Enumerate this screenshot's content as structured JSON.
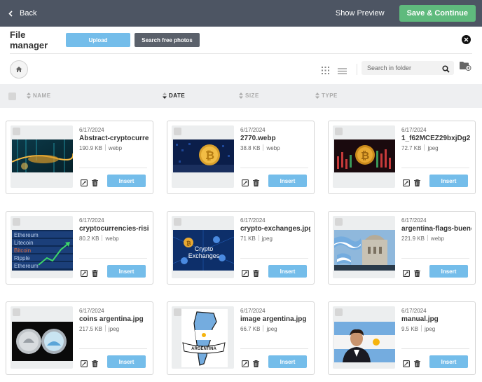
{
  "topbar": {
    "back_label": "Back",
    "show_preview_label": "Show Preview",
    "save_label": "Save & Continue"
  },
  "header": {
    "title": "File manager",
    "upload_label": "Upload",
    "search_photos_label": "Search free photos"
  },
  "toolbar": {
    "search_placeholder": "Search in folder"
  },
  "columns": {
    "name": "NAME",
    "date": "DATE",
    "size": "SIZE",
    "type": "TYPE"
  },
  "files": [
    {
      "date": "6/17/2024",
      "name": "Abstract-cryptocurrency",
      "size": "190.9 KB",
      "type": "webp",
      "thumb": "matrix"
    },
    {
      "date": "6/17/2024",
      "name": "2770.webp",
      "size": "38.8 KB",
      "type": "webp",
      "thumb": "bitcoin-blue"
    },
    {
      "date": "6/17/2024",
      "name": "1_f62MCEZ29bxjDg2",
      "size": "72.7 KB",
      "type": "jpeg",
      "thumb": "bitcoin-red"
    },
    {
      "date": "6/17/2024",
      "name": "cryptocurrencies-rising",
      "size": "80.2 KB",
      "type": "webp",
      "thumb": "crypto-rising"
    },
    {
      "date": "6/17/2024",
      "name": "crypto-exchanges.jpg",
      "size": "71 KB",
      "type": "jpeg",
      "thumb": "exchanges"
    },
    {
      "date": "6/17/2024",
      "name": "argentina-flags-buenos",
      "size": "221.9 KB",
      "type": "webp",
      "thumb": "flags"
    },
    {
      "date": "6/17/2024",
      "name": "coins argentina.jpg",
      "size": "217.5 KB",
      "type": "jpeg",
      "thumb": "coins"
    },
    {
      "date": "6/17/2024",
      "name": "image argentina.jpg",
      "size": "66.7 KB",
      "type": "jpeg",
      "thumb": "map"
    },
    {
      "date": "6/17/2024",
      "name": "manual.jpg",
      "size": "9.5 KB",
      "type": "jpeg",
      "thumb": "portrait"
    }
  ],
  "insert_label": "Insert",
  "thumb_texts": {
    "crypto_rising": [
      "Ethereum",
      "Litecoin",
      "Bitcoin",
      "Ripple",
      "Ethereum"
    ],
    "exchanges": [
      "Crypto",
      "Exchanges"
    ],
    "map_banner": "ARGENTINA"
  },
  "colors": {
    "topbar": "#4d5563",
    "save": "#5fba7d",
    "accent": "#74bdea",
    "dark_button": "#5b616b"
  }
}
